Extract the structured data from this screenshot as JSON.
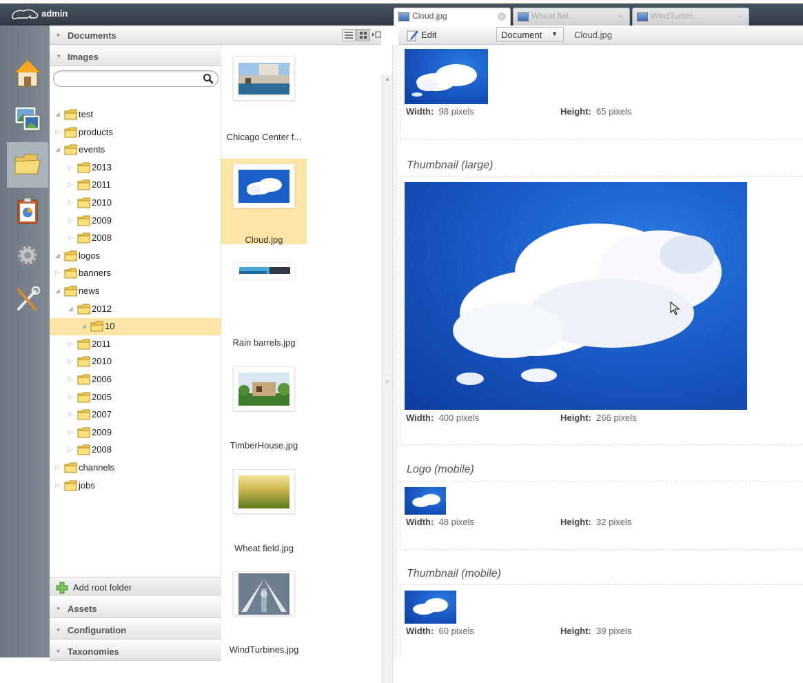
{
  "header": {
    "user": "admin",
    "tabs": [
      {
        "label": "Cloud.jpg",
        "active": true
      },
      {
        "label": "Wheat fiel..",
        "active": false
      },
      {
        "label": "WindTurbin..",
        "active": false
      }
    ]
  },
  "rail": {
    "icons": [
      "home-icon",
      "images-icon",
      "folder-icon",
      "report-icon",
      "gear-icon",
      "tools-icon"
    ],
    "active": "folder-icon"
  },
  "nav": {
    "sections": {
      "documents": "Documents",
      "images": "Images",
      "assets": "Assets",
      "configuration": "Configuration",
      "taxonomies": "Taxonomies"
    },
    "search": {
      "value": "",
      "placeholder": ""
    },
    "tree": [
      {
        "label": "test",
        "depth": 0,
        "open": true
      },
      {
        "label": "products",
        "depth": 0,
        "open": false
      },
      {
        "label": "events",
        "depth": 0,
        "open": true
      },
      {
        "label": "2013",
        "depth": 1,
        "open": false
      },
      {
        "label": "2011",
        "depth": 1,
        "open": false
      },
      {
        "label": "2010",
        "depth": 1,
        "open": false
      },
      {
        "label": "2009",
        "depth": 1,
        "open": false
      },
      {
        "label": "2008",
        "depth": 1,
        "open": false
      },
      {
        "label": "logos",
        "depth": 0,
        "open": true
      },
      {
        "label": "banners",
        "depth": 0,
        "open": false
      },
      {
        "label": "news",
        "depth": 0,
        "open": true
      },
      {
        "label": "2012",
        "depth": 1,
        "open": true
      },
      {
        "label": "10",
        "depth": 2,
        "open": true,
        "selected": true
      },
      {
        "label": "2011",
        "depth": 1,
        "open": false
      },
      {
        "label": "2010",
        "depth": 1,
        "open": false
      },
      {
        "label": "2006",
        "depth": 1,
        "open": false
      },
      {
        "label": "2005",
        "depth": 1,
        "open": false
      },
      {
        "label": "2007",
        "depth": 1,
        "open": false
      },
      {
        "label": "2009",
        "depth": 1,
        "open": false
      },
      {
        "label": "2008",
        "depth": 1,
        "open": false
      },
      {
        "label": "channels",
        "depth": 0,
        "open": false
      },
      {
        "label": "jobs",
        "depth": 0,
        "open": false
      }
    ],
    "add_root_folder": "Add root folder"
  },
  "list": {
    "items": [
      {
        "name": "Chicago Center f...",
        "selected": false
      },
      {
        "name": "Cloud.jpg",
        "selected": true
      },
      {
        "name": "Rain barrels.jpg",
        "selected": false
      },
      {
        "name": "TimberHouse.jpg",
        "selected": false
      },
      {
        "name": "Wheat field.jpg",
        "selected": false
      },
      {
        "name": "WindTurbines.jpg",
        "selected": false
      }
    ]
  },
  "editor": {
    "edit_label": "Edit",
    "doc_type": "Document",
    "doc_name": "Cloud.jpg",
    "width_label": "Width:",
    "height_label": "Height:",
    "variants": [
      {
        "title": "",
        "width": "98 pixels",
        "height": "65 pixels"
      },
      {
        "title": "Thumbnail (large)",
        "width": "400 pixels",
        "height": "266 pixels"
      },
      {
        "title": "Logo (mobile)",
        "width": "48 pixels",
        "height": "32 pixels"
      },
      {
        "title": "Thumbnail (mobile)",
        "width": "60 pixels",
        "height": "39 pixels"
      }
    ]
  },
  "colors": {
    "topbar": "#3a4550",
    "rail": "#76808a",
    "selection": "#fde6a5",
    "sky": "#1a5cc8"
  }
}
